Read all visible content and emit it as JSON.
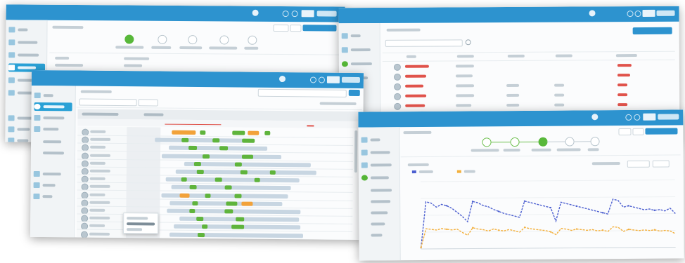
{
  "colors": {
    "header": "#2d93cf",
    "sidebar_active": "#2aa1d6",
    "gantt_bar_grey": "#c8d6e2",
    "gantt_bar_green": "#5fb43c",
    "gantt_bar_orange": "#f2a23a",
    "series_blue": "#4c5fd0",
    "series_orange": "#f3b03d",
    "error_red": "#e0534b"
  },
  "icons": [
    "user-avatar-icon",
    "bell-icon",
    "settings-icon",
    "logo-icon",
    "search-icon",
    "filter-icon"
  ],
  "chart_data": {
    "type": "line",
    "title": "",
    "xlabel": "",
    "ylabel": "",
    "x": [
      1,
      2,
      3,
      4,
      5,
      6,
      7,
      8,
      9,
      10,
      11,
      12,
      13,
      14,
      15,
      16,
      17,
      18,
      19,
      20,
      21,
      22,
      23,
      24,
      25,
      26,
      27,
      28,
      29,
      30,
      31,
      32,
      33,
      34,
      35,
      36,
      37,
      38,
      39,
      40,
      41,
      42,
      43,
      44,
      45,
      46,
      47,
      48,
      49,
      50
    ],
    "ylim": [
      0,
      100
    ],
    "series": [
      {
        "color": "#4c5fd0",
        "values": [
          2,
          70,
          68,
          62,
          66,
          64,
          60,
          54,
          48,
          40,
          70,
          68,
          64,
          62,
          58,
          55,
          52,
          50,
          48,
          46,
          70,
          68,
          66,
          64,
          62,
          60,
          40,
          68,
          66,
          64,
          62,
          60,
          58,
          56,
          54,
          52,
          50,
          72,
          70,
          60,
          62,
          60,
          58,
          56,
          57,
          55,
          56,
          54,
          58,
          50
        ]
      },
      {
        "color": "#f3b03d",
        "values": [
          2,
          30,
          29,
          28,
          30,
          29,
          28,
          29,
          24,
          20,
          31,
          29,
          28,
          26,
          29,
          27,
          26,
          28,
          26,
          24,
          31,
          29,
          28,
          27,
          26,
          24,
          20,
          29,
          28,
          26,
          28,
          27,
          26,
          27,
          25,
          26,
          24,
          31,
          30,
          24,
          27,
          26,
          25,
          26,
          25,
          26,
          24,
          25,
          24,
          20
        ]
      }
    ]
  }
}
